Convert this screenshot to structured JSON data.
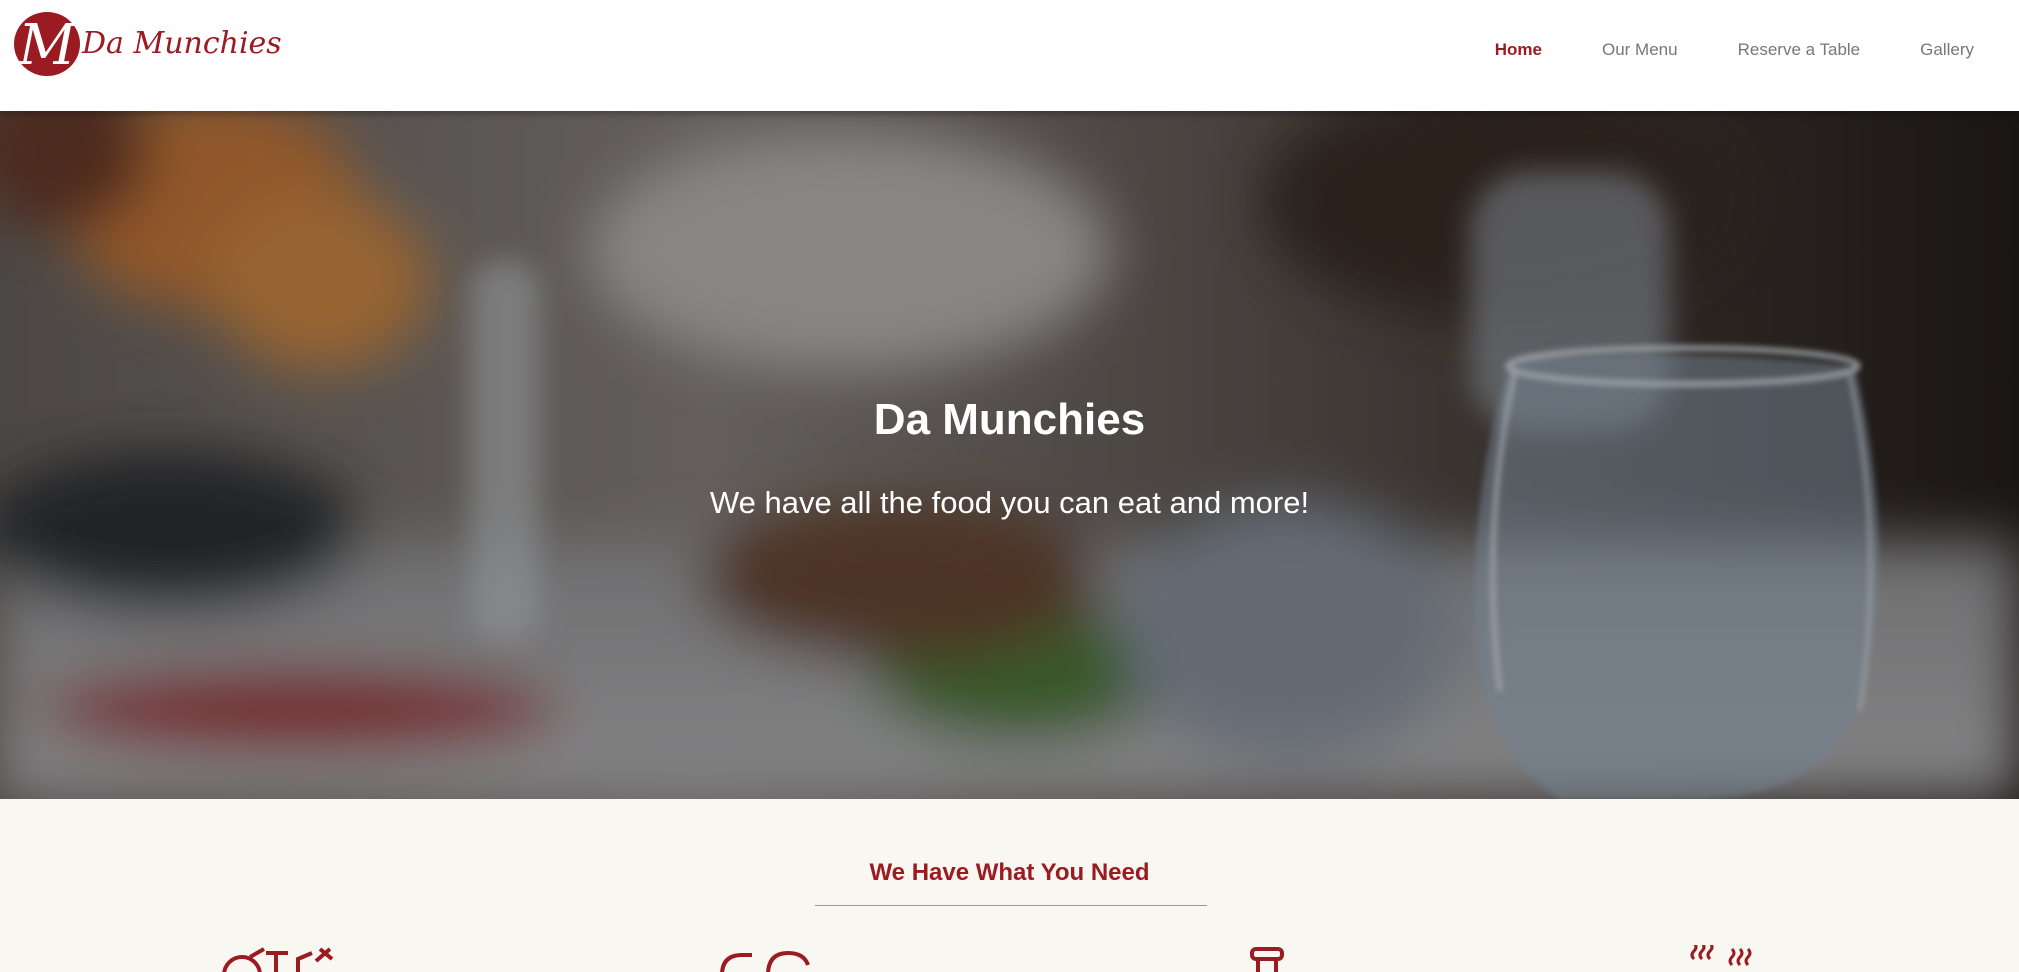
{
  "brand": {
    "name": "Da Munchies",
    "logo_letter": "M",
    "color": "#9b1b22"
  },
  "nav": {
    "items": [
      {
        "label": "Home",
        "active": true
      },
      {
        "label": "Our Menu",
        "active": false
      },
      {
        "label": "Reserve a Table",
        "active": false
      },
      {
        "label": "Gallery",
        "active": false
      }
    ]
  },
  "hero": {
    "title": "Da Munchies",
    "subtitle": "We have all the food you can eat and more!",
    "background": "blurred-restaurant-table-photo"
  },
  "features": {
    "title": "We Have What You Need",
    "icons": [
      "produce-icon",
      "serving-cloche-icon",
      "drink-icon",
      "hot-dish-icon"
    ]
  }
}
